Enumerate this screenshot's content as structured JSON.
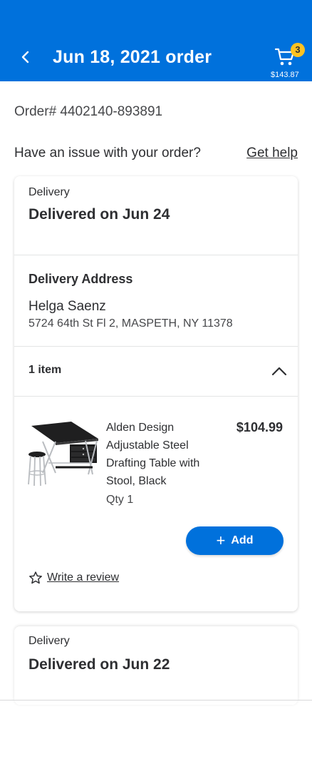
{
  "header": {
    "title": "Jun 18, 2021 order",
    "back_icon": "chevron-left-icon",
    "cart": {
      "count": "3",
      "total": "$143.87",
      "icon": "cart-icon"
    },
    "background": "#0071dc"
  },
  "order": {
    "number_label": "Order# 4402140-893891",
    "issue_text": "Have an issue with your order?",
    "get_help_label": "Get help"
  },
  "shipment1": {
    "type_label": "Delivery",
    "status": "Delivered on Jun 24",
    "address": {
      "title": "Delivery Address",
      "name": "Helga Saenz",
      "line": "5724 64th St Fl 2, MASPETH, NY 11378"
    },
    "items_label": "1 item",
    "items_icon": "chevron-up-icon",
    "product": {
      "name": "Alden Design Adjustable Steel Drafting Table with Stool, Black",
      "price": "$104.99",
      "qty": "Qty 1",
      "add_label": "Add",
      "add_icon": "plus-icon",
      "review_label": "Write a review",
      "review_icon": "star-outline-icon"
    }
  },
  "shipment2": {
    "type_label": "Delivery",
    "status": "Delivered on Jun 22"
  }
}
